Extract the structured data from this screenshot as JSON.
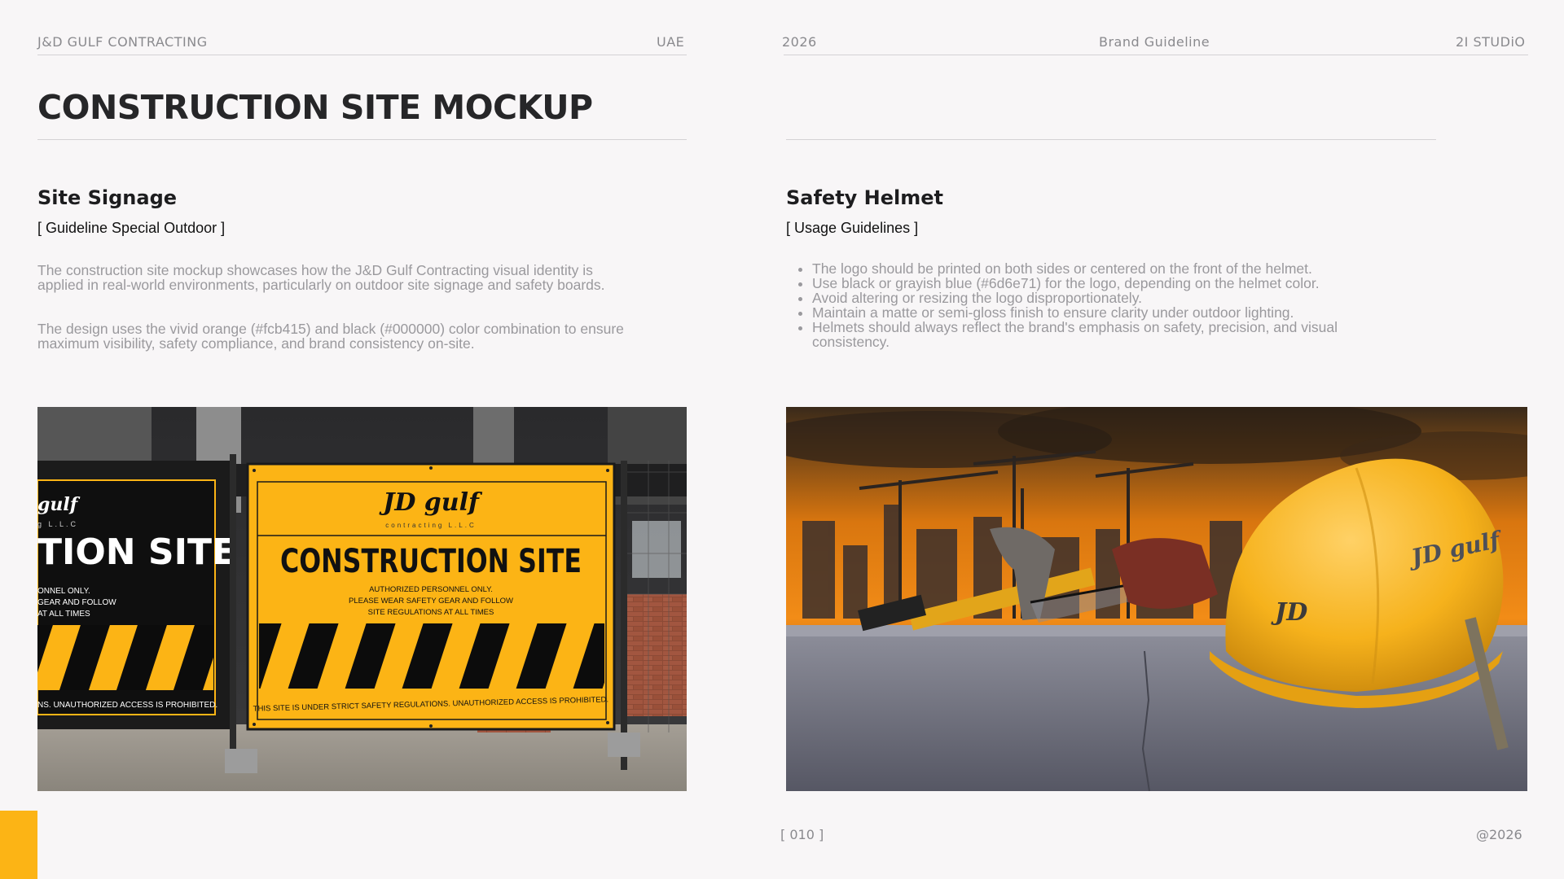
{
  "header": {
    "company": "J&D GULF CONTRACTING",
    "country": "UAE",
    "year": "2026",
    "doc_type": "Brand Guideline",
    "studio": "2I STUDiO"
  },
  "page_title": "CONSTRUCTION SITE MOCKUP",
  "left": {
    "heading": "Site Signage",
    "tag": "[ Guideline Special Outdoor ]",
    "paragraphs": [
      "The construction site mockup showcases how the J&D Gulf Contracting visual identity is applied in real-world environments, particularly on outdoor site signage and safety boards.",
      "The design uses the vivid orange (#fcb415) and black (#000000) color combination to ensure maximum visibility, safety compliance, and brand consistency on-site."
    ],
    "sign": {
      "logo": "JD gulf",
      "logo_sub": "contracting L.L.C",
      "headline": "CONSTRUCTION SITE",
      "lines": [
        "AUTHORIZED PERSONNEL ONLY.",
        "PLEASE WEAR SAFETY GEAR AND FOLLOW",
        "SITE REGULATIONS AT ALL TIMES"
      ],
      "bottom": "THIS SITE IS UNDER STRICT SAFETY REGULATIONS. UNAUTHORIZED ACCESS IS PROHIBITED.",
      "left_headline": "TION SITE",
      "left_logo_sub": "g L.L.C",
      "left_lines": [
        "ONNEL ONLY.",
        "GEAR AND FOLLOW",
        "AT ALL TIMES"
      ],
      "left_bottom": "NS. UNAUTHORIZED ACCESS IS PROHIBITED."
    }
  },
  "right": {
    "heading": "Safety Helmet",
    "tag": "[ Usage Guidelines ]",
    "bullets": [
      "The logo should be printed on both sides or centered on the front of the helmet.",
      "Use black or grayish blue (#6d6e71) for the logo, depending on the helmet color.",
      "Avoid altering or resizing the logo disproportionately.",
      "Maintain a matte or semi-gloss finish to ensure clarity under outdoor lighting.",
      "Helmets should always reflect the brand's emphasis on safety, precision, and visual consistency."
    ],
    "helmet": {
      "logo": "JD",
      "side_logo": "JD gulf"
    }
  },
  "footer": {
    "page": "[ 010 ]",
    "copyright": "@2026"
  },
  "colors": {
    "brand_orange": "#fcb415",
    "black": "#000000",
    "gray_blue": "#6d6e71"
  }
}
